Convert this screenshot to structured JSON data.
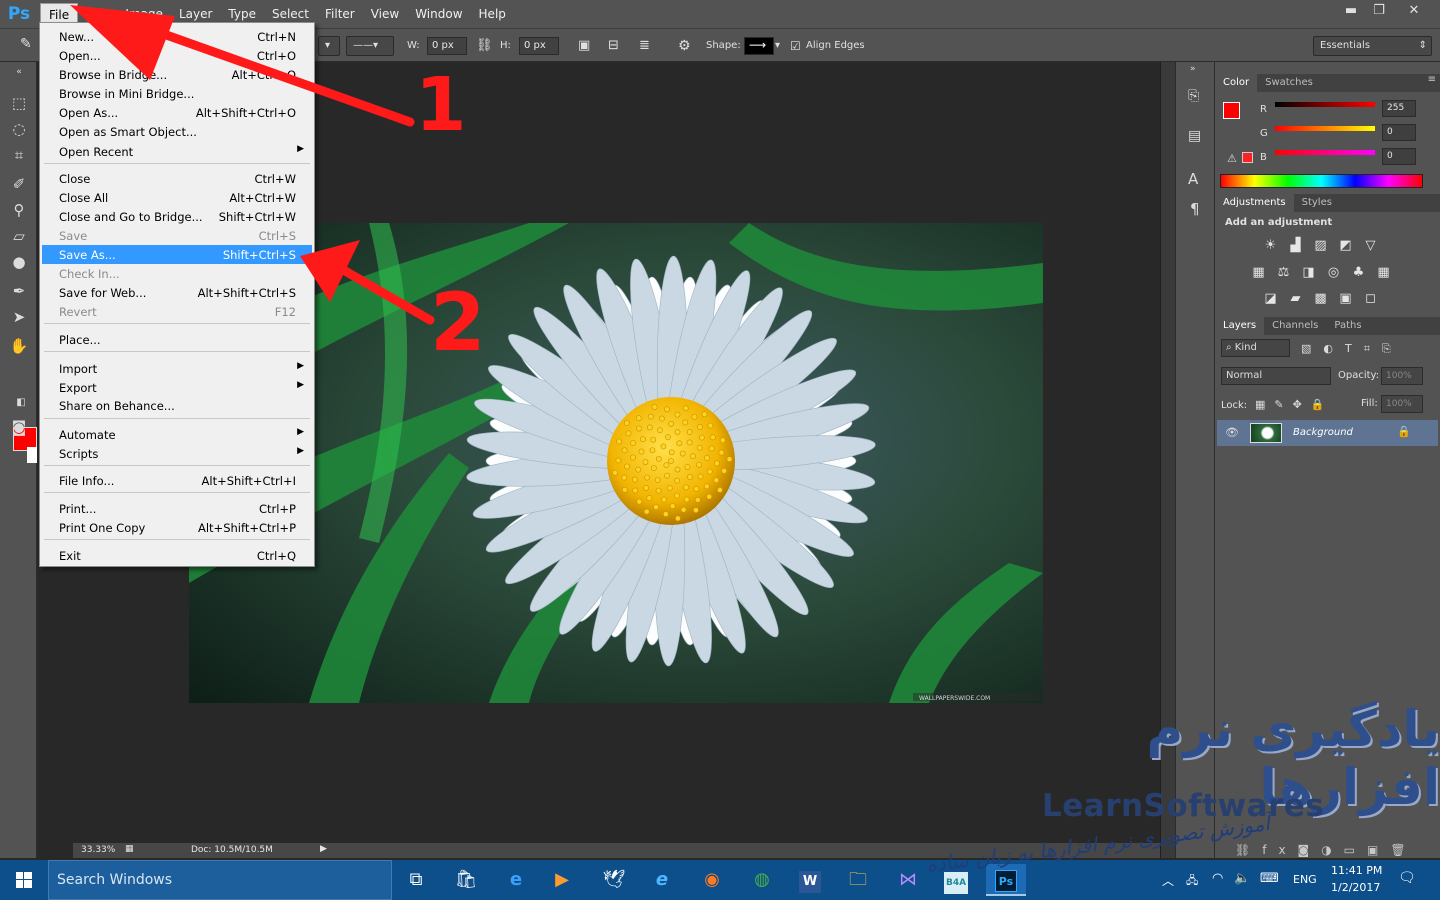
{
  "app": {
    "logo": "Ps"
  },
  "menubar": {
    "items": [
      "File",
      "Edit",
      "Image",
      "Layer",
      "Type",
      "Select",
      "Filter",
      "View",
      "Window",
      "Help"
    ],
    "active": "File"
  },
  "window_controls": {
    "minimize": "▬",
    "restore": "❐",
    "close": "✕"
  },
  "options": {
    "w_label": "W:",
    "w_value": "0 px",
    "h_label": "H:",
    "h_value": "0 px",
    "shape_label": "Shape:",
    "align_edges": "Align Edges",
    "workspace": "Essentials"
  },
  "file_menu": {
    "items": [
      {
        "label": "New...",
        "shortcut": "Ctrl+N"
      },
      {
        "label": "Open...",
        "shortcut": "Ctrl+O"
      },
      {
        "label": "Browse in Bridge...",
        "shortcut": "Alt+Ctrl+O"
      },
      {
        "label": "Browse in Mini Bridge...",
        "shortcut": ""
      },
      {
        "label": "Open As...",
        "shortcut": "Alt+Shift+Ctrl+O"
      },
      {
        "label": "Open as Smart Object...",
        "shortcut": ""
      },
      {
        "label": "Open Recent",
        "shortcut": ""
      },
      {
        "label": "Close",
        "shortcut": "Ctrl+W"
      },
      {
        "label": "Close All",
        "shortcut": "Alt+Ctrl+W"
      },
      {
        "label": "Close and Go to Bridge...",
        "shortcut": "Shift+Ctrl+W"
      },
      {
        "label": "Save",
        "shortcut": "Ctrl+S"
      },
      {
        "label": "Save As...",
        "shortcut": "Shift+Ctrl+S"
      },
      {
        "label": "Check In...",
        "shortcut": ""
      },
      {
        "label": "Save for Web...",
        "shortcut": "Alt+Shift+Ctrl+S"
      },
      {
        "label": "Revert",
        "shortcut": "F12"
      },
      {
        "label": "Place...",
        "shortcut": ""
      },
      {
        "label": "Import",
        "shortcut": ""
      },
      {
        "label": "Export",
        "shortcut": ""
      },
      {
        "label": "Share on Behance...",
        "shortcut": ""
      },
      {
        "label": "Automate",
        "shortcut": ""
      },
      {
        "label": "Scripts",
        "shortcut": ""
      },
      {
        "label": "File Info...",
        "shortcut": "Alt+Shift+Ctrl+I"
      },
      {
        "label": "Print...",
        "shortcut": "Ctrl+P"
      },
      {
        "label": "Print One Copy",
        "shortcut": "Alt+Shift+Ctrl+P"
      },
      {
        "label": "Exit",
        "shortcut": "Ctrl+Q"
      }
    ],
    "highlighted": "Save As..."
  },
  "annotations": {
    "step1": "1",
    "step2": "2"
  },
  "color_panel": {
    "tabs": [
      "Color",
      "Swatches"
    ],
    "r_label": "R",
    "g_label": "G",
    "b_label": "B",
    "r": "255",
    "g": "0",
    "b": "0",
    "foreground": "#ff0000"
  },
  "adjustments_panel": {
    "tabs": [
      "Adjustments",
      "Styles"
    ],
    "heading": "Add an adjustment"
  },
  "layers_panel": {
    "tabs": [
      "Layers",
      "Channels",
      "Paths"
    ],
    "kind": "Kind",
    "blend_mode": "Normal",
    "opacity_label": "Opacity:",
    "opacity": "100%",
    "lock_label": "Lock:",
    "fill_label": "Fill:",
    "fill": "100%",
    "layer_name": "Background"
  },
  "status": {
    "zoom": "33.33%",
    "doc": "Doc: 10.5M/10.5M"
  },
  "image_credit": "WALLPAPERSWIDE.COM",
  "watermark": {
    "persian_title": "یادگیری نرم افزارها",
    "english": "LearnSoftwares",
    "persian_sub": "آموزش تصویری نرم افزارها به زبان ساده"
  },
  "taskbar": {
    "search_placeholder": "Search Windows",
    "language": "ENG",
    "time": "11:41 PM",
    "date": "1/2/2017",
    "app_label_b4a": "B4A",
    "app_label_ps": "Ps",
    "app_label_word": "W"
  }
}
